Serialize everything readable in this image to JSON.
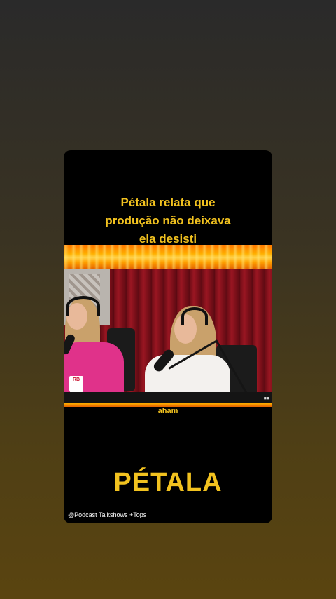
{
  "card": {
    "headline_lines": [
      "Pétala relata que",
      "produção não deixava",
      "ela desisti"
    ],
    "video_caption": "aham",
    "mug_label": "RB",
    "name_title": "PÉTALA",
    "channel_handle": "@Podcast Talkshows +Tops"
  },
  "colors": {
    "accent_yellow": "#f2c21f",
    "fire_orange": "#ff9a00",
    "card_background": "#000000",
    "curtain_red": "#8a1420",
    "pink_blazer": "#e0328a"
  }
}
